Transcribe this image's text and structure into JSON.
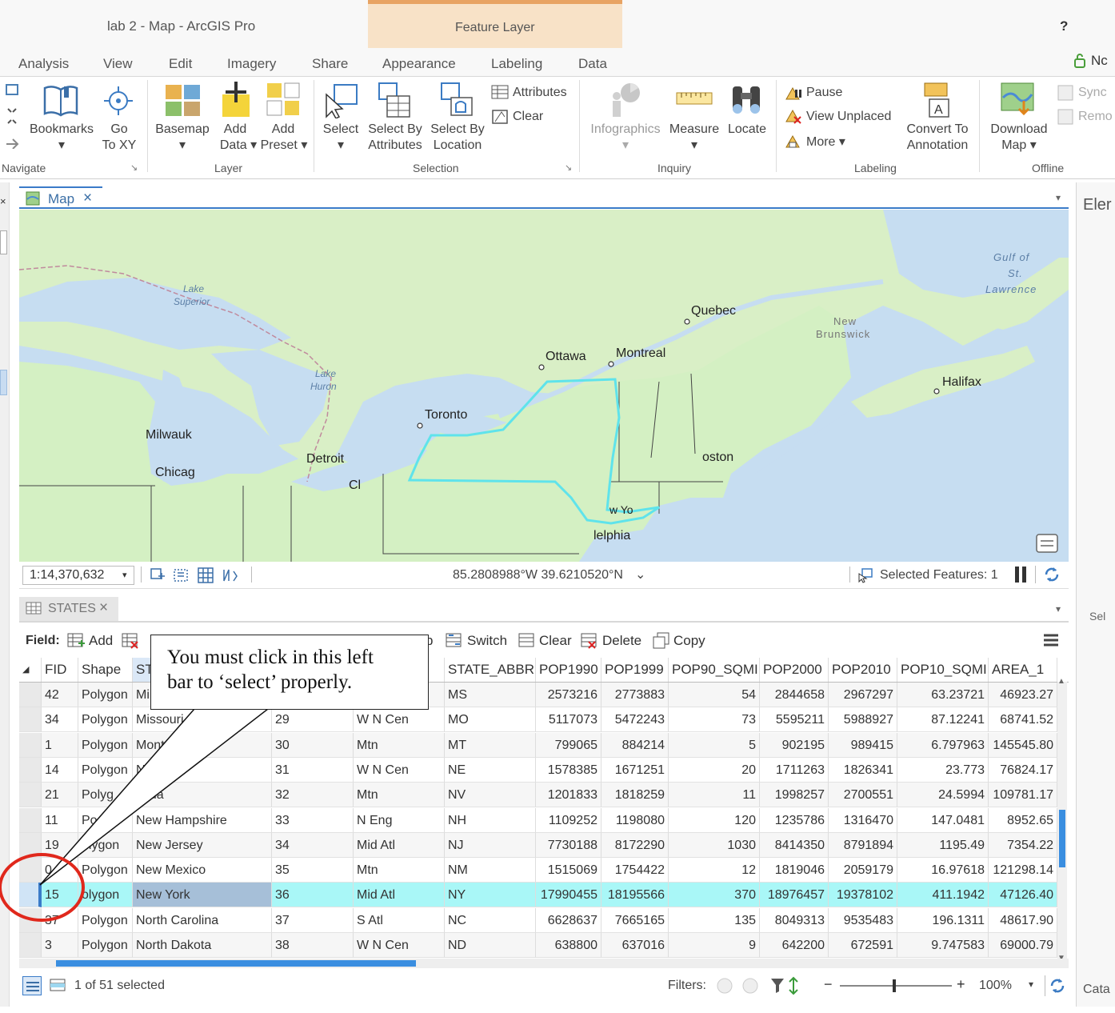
{
  "window": {
    "title": "lab 2 - Map - ArcGIS Pro",
    "context_tab_group": "Feature Layer",
    "help": "?",
    "signin": "Nc"
  },
  "tabs": [
    "Analysis",
    "View",
    "Edit",
    "Imagery",
    "Share",
    "Appearance",
    "Labeling",
    "Data"
  ],
  "ribbon": {
    "navigate": {
      "bookmarks": "Bookmarks",
      "go_to_xy_1": "Go",
      "go_to_xy_2": "To XY",
      "group": "Navigate"
    },
    "layer": {
      "basemap": "Basemap",
      "add_data_1": "Add",
      "add_data_2": "Data",
      "add_preset_1": "Add",
      "add_preset_2": "Preset",
      "group": "Layer"
    },
    "selection": {
      "select": "Select",
      "select_by_attr_1": "Select By",
      "select_by_attr_2": "Attributes",
      "select_by_loc_1": "Select By",
      "select_by_loc_2": "Location",
      "attributes": "Attributes",
      "clear": "Clear",
      "group": "Selection"
    },
    "inquiry": {
      "infographics": "Infographics",
      "measure": "Measure",
      "locate": "Locate",
      "group": "Inquiry"
    },
    "labeling": {
      "pause": "Pause",
      "view_unplaced": "View Unplaced",
      "more": "More",
      "convert_1": "Convert To",
      "convert_2": "Annotation",
      "group": "Labeling"
    },
    "offline": {
      "download_1": "Download",
      "download_2": "Map",
      "sync": "Sync",
      "remove": "Remo",
      "group": "Offline"
    }
  },
  "map_view": {
    "tab": "Map",
    "labels": {
      "lake_superior_1": "Lake",
      "lake_superior_2": "Superior",
      "lake_huron_1": "Lake",
      "lake_huron_2": "Huron",
      "gulf_1": "Gulf of",
      "gulf_2": "St.",
      "gulf_3": "Lawrence",
      "new_brunswick_1": "New",
      "new_brunswick_2": "Brunswick",
      "quebec": "Quebec",
      "ottawa": "Ottawa",
      "montreal": "Montreal",
      "halifax": "Halifax",
      "toronto": "Toronto",
      "milwaukee": "Milwauk",
      "chicago": "Chicag",
      "detroit": "Detroit",
      "cleveland": "Cl",
      "boston": "oston",
      "new_york": "w Yo",
      "philadelphia": "lelphia"
    },
    "scale": "1:14,370,632",
    "coordinates": "85.2808988°W 39.6210520°N",
    "selected_features": "Selected Features: 1"
  },
  "right_panel": {
    "top": "Eler",
    "mid": "Sel",
    "bottom": "Cata"
  },
  "table": {
    "tab": "STATES",
    "toolbar": {
      "field_label": "Field:",
      "add": "Add",
      "switch": "Switch",
      "clear": "Clear",
      "delete": "Delete",
      "copy": "Copy",
      "partial": "p"
    },
    "columns": [
      "FID",
      "Shape",
      "ST",
      "N",
      "",
      "STATE_ABBR",
      "POP1990",
      "POP1999",
      "POP90_SQMI",
      "POP2000",
      "POP2010",
      "POP10_SQMI",
      "AREA_1"
    ],
    "rows": [
      {
        "fid": "42",
        "shape": "Polygon",
        "name": "Mi",
        "fips": "",
        "sub": "",
        "abbr": "MS",
        "p90": "2573216",
        "p99": "2773883",
        "sq90": "54",
        "p00": "2844658",
        "p10": "2967297",
        "sq10": "63.23721",
        "area": "46923.27"
      },
      {
        "fid": "34",
        "shape": "Polygon",
        "name": "Missouri",
        "fips": "29",
        "sub": "W N Cen",
        "abbr": "MO",
        "p90": "5117073",
        "p99": "5472243",
        "sq90": "73",
        "p00": "5595211",
        "p10": "5988927",
        "sq10": "87.12241",
        "area": "68741.52"
      },
      {
        "fid": "1",
        "shape": "Polygon",
        "name": "Mont",
        "fips": "30",
        "sub": "Mtn",
        "abbr": "MT",
        "p90": "799065",
        "p99": "884214",
        "sq90": "5",
        "p00": "902195",
        "p10": "989415",
        "sq10": "6.797963",
        "area": "145545.80"
      },
      {
        "fid": "14",
        "shape": "Polygon",
        "name": "N",
        "fips": "31",
        "sub": "W N Cen",
        "abbr": "NE",
        "p90": "1578385",
        "p99": "1671251",
        "sq90": "20",
        "p00": "1711263",
        "p10": "1826341",
        "sq10": "23.773",
        "area": "76824.17"
      },
      {
        "fid": "21",
        "shape": "Polyg",
        "name": "vada",
        "fips": "32",
        "sub": "Mtn",
        "abbr": "NV",
        "p90": "1201833",
        "p99": "1818259",
        "sq90": "11",
        "p00": "1998257",
        "p10": "2700551",
        "sq10": "24.5994",
        "area": "109781.17"
      },
      {
        "fid": "11",
        "shape": "Po n",
        "name": "New Hampshire",
        "fips": "33",
        "sub": "N Eng",
        "abbr": "NH",
        "p90": "1109252",
        "p99": "1198080",
        "sq90": "120",
        "p00": "1235786",
        "p10": "1316470",
        "sq10": "147.0481",
        "area": "8952.65"
      },
      {
        "fid": "19",
        "shape": "olygon",
        "name": "New Jersey",
        "fips": "34",
        "sub": "Mid Atl",
        "abbr": "NJ",
        "p90": "7730188",
        "p99": "8172290",
        "sq90": "1030",
        "p00": "8414350",
        "p10": "8791894",
        "sq10": "1195.49",
        "area": "7354.22"
      },
      {
        "fid": "0",
        "shape": "Polygon",
        "name": "New Mexico",
        "fips": "35",
        "sub": "Mtn",
        "abbr": "NM",
        "p90": "1515069",
        "p99": "1754422",
        "sq90": "12",
        "p00": "1819046",
        "p10": "2059179",
        "sq10": "16.97618",
        "area": "121298.14"
      },
      {
        "fid": "15",
        "shape": "olygon",
        "name": "New York",
        "fips": "36",
        "sub": "Mid Atl",
        "abbr": "NY",
        "p90": "17990455",
        "p99": "18195566",
        "sq90": "370",
        "p00": "18976457",
        "p10": "19378102",
        "sq10": "411.1942",
        "area": "47126.40"
      },
      {
        "fid": "37",
        "shape": "Polygon",
        "name": "North Carolina",
        "fips": "37",
        "sub": "S Atl",
        "abbr": "NC",
        "p90": "6628637",
        "p99": "7665165",
        "sq90": "135",
        "p00": "8049313",
        "p10": "9535483",
        "sq10": "196.1311",
        "area": "48617.90"
      },
      {
        "fid": "3",
        "shape": "Polygon",
        "name": "North Dakota",
        "fips": "38",
        "sub": "W N Cen",
        "abbr": "ND",
        "p90": "638800",
        "p99": "637016",
        "sq90": "9",
        "p00": "642200",
        "p10": "672591",
        "sq10": "9.747583",
        "area": "69000.79"
      }
    ],
    "selected_row_index": 8,
    "footer": {
      "selected": "1 of 51 selected",
      "filters": "Filters:",
      "zoom": "100%"
    }
  },
  "callout": {
    "line1": "You must click in this left",
    "line2": "bar to ‘select’ properly."
  },
  "colors": {
    "accent": "#3a7bc8",
    "context_tab": "#f8e2c7",
    "context_top": "#e8a363",
    "selected_row": "#a9f7f7",
    "selection_outline": "#5fe3eb",
    "land": "#d4f0c3",
    "water": "#c6ddf1",
    "circle": "#e0281c"
  }
}
